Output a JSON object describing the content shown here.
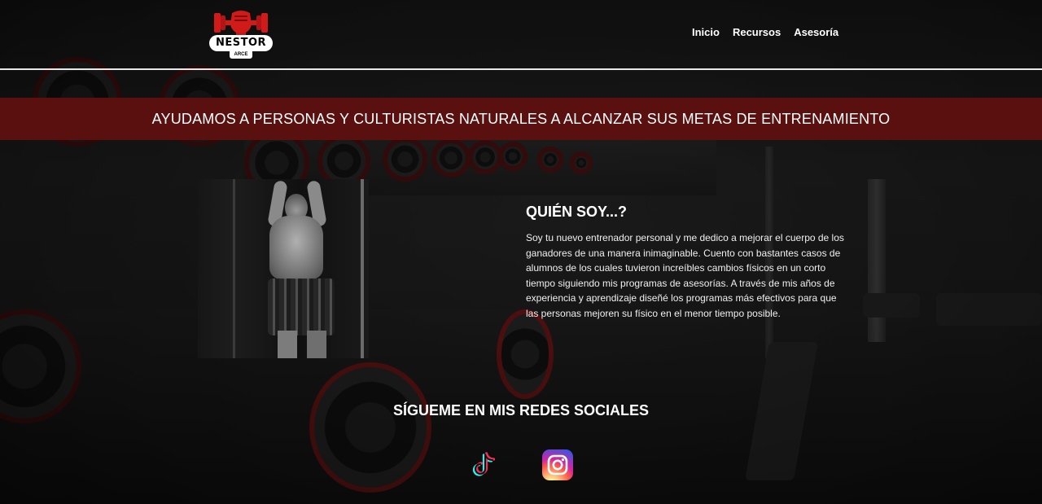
{
  "brand": {
    "name": "NESTOR",
    "subname": "ARCE",
    "logo_icon": "fist-dumbbell-icon",
    "accent_color": "#d11a1a"
  },
  "nav": {
    "items": [
      {
        "label": "Inicio"
      },
      {
        "label": "Recursos"
      },
      {
        "label": "Asesoría"
      }
    ]
  },
  "banner": {
    "text": "AYUDAMOS A PERSONAS Y CULTURISTAS NATURALES A ALCANZAR SUS METAS DE ENTRENAMIENTO",
    "background_color": "#5b1010"
  },
  "about": {
    "title": "QUIÉN SOY...?",
    "body": "Soy tu nuevo entrenador personal y me dedico a mejorar el cuerpo de los ganadores de una manera inimaginable. Cuento con bastantes casos de alumnos de los cuales tuvieron increíbles cambios físicos en un corto tiempo siguiendo mis programas de asesorías. A través de mis años de experiencia y aprendizaje diseñé los programas más efectivos para que las personas mejoren su físico en el menor tiempo posible."
  },
  "social": {
    "title": "SÍGUEME EN MIS REDES SOCIALES",
    "links": [
      {
        "icon": "tiktok-icon"
      },
      {
        "icon": "instagram-icon"
      }
    ]
  }
}
